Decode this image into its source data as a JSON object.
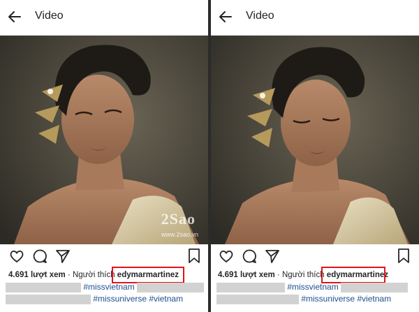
{
  "header": {
    "title": "Video"
  },
  "stats": {
    "views": "4.691 lượt xem",
    "separator": "·",
    "liked_by_label": "Người thích",
    "liker": "edymarmartinez"
  },
  "caption": {
    "line1_tag": "#missvietnam",
    "line2_tags": "#missuniverse #vietnam"
  },
  "watermark": {
    "logo": "2Sao",
    "url": "www.2sao.vn"
  },
  "icons": [
    "back-arrow-icon",
    "heart-icon",
    "comment-icon",
    "share-icon",
    "bookmark-icon"
  ],
  "colors": {
    "highlight": "#e0141b",
    "hashtag": "#1e4e8c",
    "divider": "#2b2b2b"
  }
}
